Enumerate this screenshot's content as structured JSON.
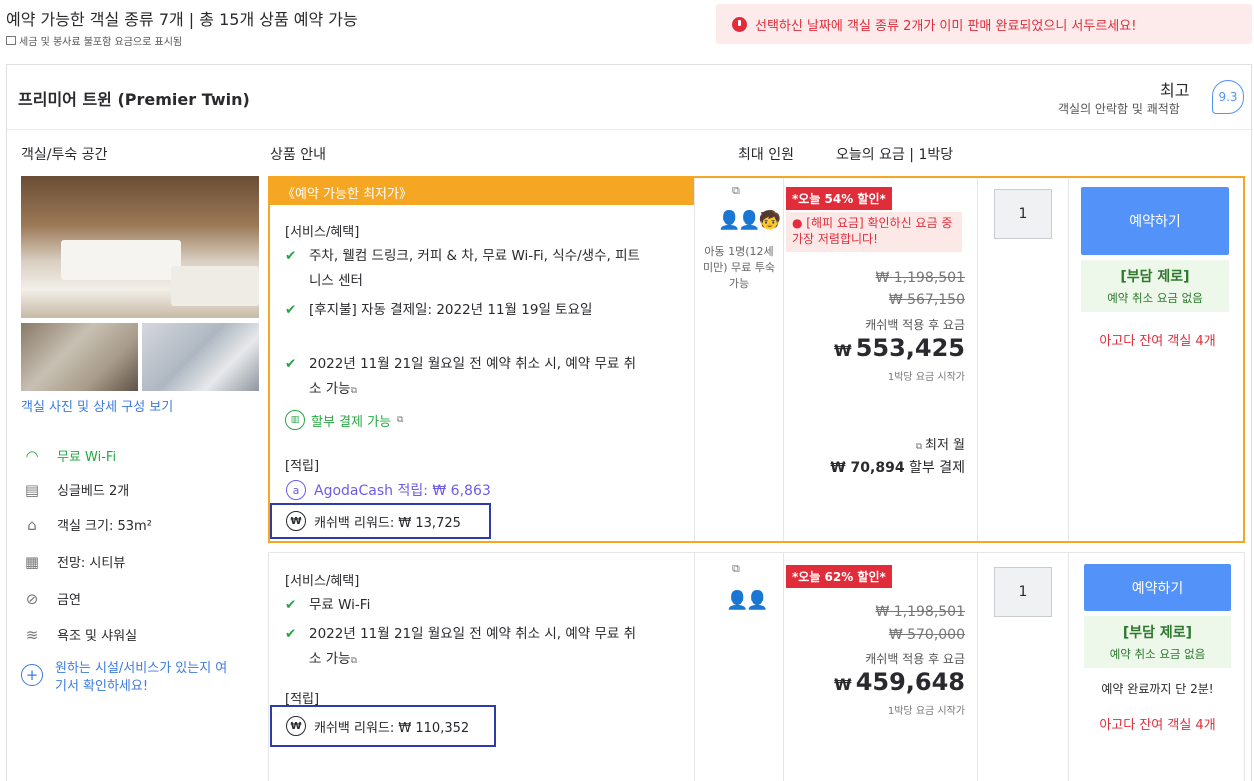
{
  "header": {
    "title": "예약 가능한 객실 종류 7개 | 총 15개 상품 예약 가능",
    "subtitle": "세금 및 봉사료 불포함 요금으로 표시됨",
    "alert": "선택하신 날짜에 객실 종류 2개가 이미 판매 완료되었으니 서두르세요!"
  },
  "room": {
    "name": "프리미어 트윈 (Premier Twin)",
    "rating_word": "최고",
    "rating_sub": "객실의 안락함 및 쾌적함",
    "rating_score": "9.3"
  },
  "columns": {
    "room": "객실/투숙 공간",
    "offer": "상품 안내",
    "occupancy": "최대 인원",
    "price": "오늘의 요금 | 1박당"
  },
  "left": {
    "photo_link": "객실 사진 및 상세 구성 보기",
    "amenities": [
      {
        "icon": "wifi-icon",
        "label": "무료 Wi-Fi"
      },
      {
        "icon": "bed-icon",
        "label": "싱글베드 2개"
      },
      {
        "icon": "house-icon",
        "label": "객실 크기: 53m²"
      },
      {
        "icon": "window-icon",
        "label": "전망: 시티뷰"
      },
      {
        "icon": "no-smoking-icon",
        "label": "금연"
      },
      {
        "icon": "bath-icon",
        "label": "욕조 및 샤워실"
      }
    ],
    "more_facilities": "원하는 시설/서비스가 있는지 여기서 확인하세요!"
  },
  "offers": [
    {
      "banner": "《예약 가능한 최저가》",
      "benefits_heading": "[서비스/혜택]",
      "benefits": [
        "주차, 웰컴 드링크, 커피 & 차, 무료 Wi-Fi, 식수/생수, 피트니스 센터",
        "[후지불] 자동 결제일: 2022년 11월 19일 토요일",
        "2022년 11월 21일 월요일 전 예약 취소 시, 예약 무료 취소 가능"
      ],
      "installment": "할부 결제 가능",
      "rewards_heading": "[적립]",
      "agoda_cash": "AgodaCash 적립: ₩ 6,863",
      "cashback": "캐쉬백 리워드: ₩ 13,725",
      "occupancy_note": "아동 1명(12세 미만) 무료 투숙 가능",
      "discount": "*오늘 54% 할인*",
      "happy_rate": "[해피 요금] 확인하신 요금 중 가장 저렴합니다!",
      "strike_prices": [
        "₩ 1,198,501",
        "₩ 567,150"
      ],
      "after_cashback": "캐쉬백 적용 후 요금",
      "currency": "₩",
      "price": "553,425",
      "price_start": "1박당 요금 시작가",
      "installment_min": "최저 월",
      "installment_value": "₩ 70,894",
      "installment_suffix": "할부 결제",
      "quantity": "1",
      "book": "예약하기",
      "free_cancel_title": "[부담 제로]",
      "free_cancel_sub": "예약 취소 요금 없음",
      "booked_ago": "",
      "rooms_left": "아고다 잔여 객실 4개"
    },
    {
      "benefits_heading": "[서비스/혜택]",
      "benefits": [
        "무료 Wi-Fi",
        "2022년 11월 21일 월요일 전 예약 취소 시, 예약 무료 취소 가능"
      ],
      "rewards_heading": "[적립]",
      "cashback": "캐쉬백 리워드: ₩ 110,352",
      "discount": "*오늘 62% 할인*",
      "strike_prices": [
        "₩ 1,198,501",
        "₩ 570,000"
      ],
      "after_cashback": "캐쉬백 적용 후 요금",
      "currency": "₩",
      "price": "459,648",
      "price_start": "1박당 요금 시작가",
      "quantity": "1",
      "book": "예약하기",
      "free_cancel_title": "[부담 제로]",
      "free_cancel_sub": "예약 취소 요금 없음",
      "booked_ago": "예약 완료까지 단 2분!",
      "rooms_left": "아고다 잔여 객실 4개"
    }
  ]
}
